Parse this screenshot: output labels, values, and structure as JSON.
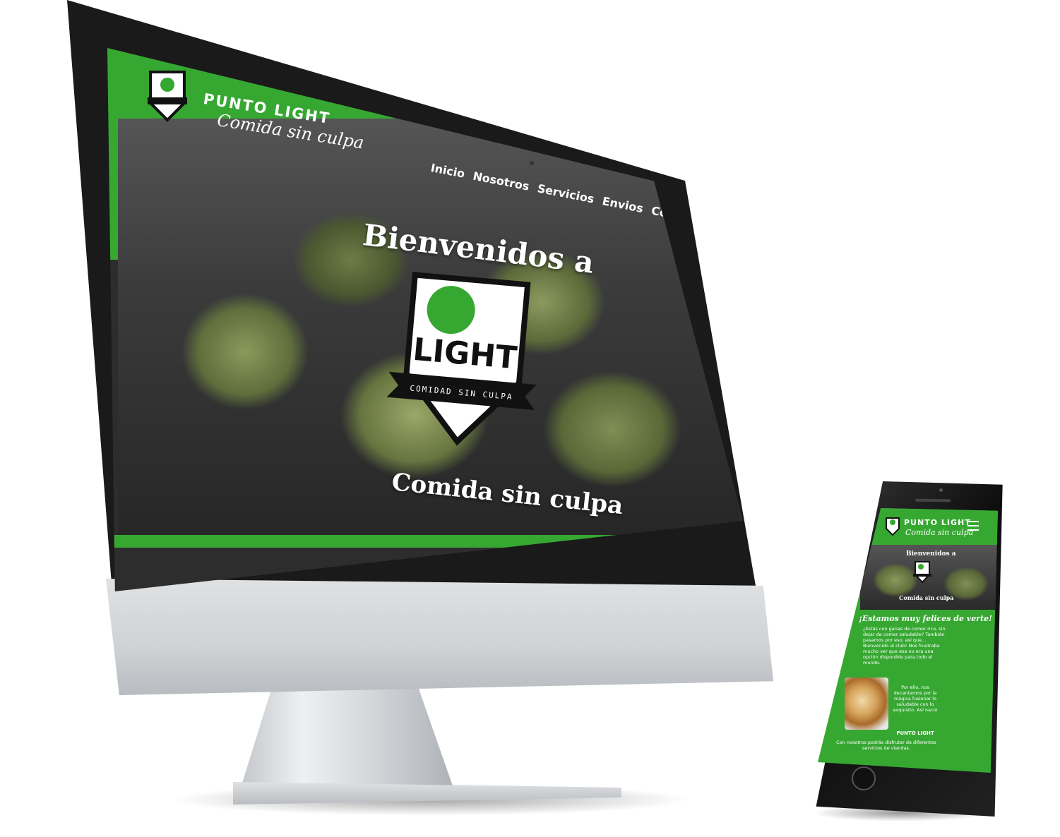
{
  "desktop": {
    "brand": {
      "name": "PUNTO LIGHT",
      "tagline": "Comida sin culpa"
    },
    "nav": [
      "Inicio",
      "Nosotros",
      "Servicios",
      "Envios",
      "Contacto"
    ],
    "hero": {
      "title": "Bienvenidos a",
      "logo_word": "LIGHT",
      "logo_ribbon": "COMIDAD SIN CULPA",
      "subtitle": "Comida sin culpa"
    }
  },
  "mobile": {
    "brand": {
      "name": "PUNTO LIGHT",
      "tagline": "Comida sin culpa"
    },
    "hero": {
      "title": "Bienvenidos a",
      "subtitle": "Comida sin culpa"
    },
    "heading": "¡Estamos muy felices de verte!",
    "paragraph_1": "¿Estás con ganas de comer rico, sin dejar de comer saludable? También pasamos por eso, así que... Bienvenido al club! Nos frustraba mucho ver que esa no era una opción disponible para todo el mundo.",
    "paragraph_2": "Por ello, nos decantamos por la mágica fusionar lo saludable con lo exquisito. Así nació",
    "brand_strong": "PUNTO LIGHT",
    "paragraph_3": "Con nosotros podrás disfrutar de diferentes servicios de viandas."
  },
  "colors": {
    "brand_green": "#36a832",
    "device_black": "#1a1a1a",
    "aluminum": "#d0d3d6"
  },
  "icons": [
    "hamburger-menu-icon",
    "shield-logo-icon"
  ]
}
